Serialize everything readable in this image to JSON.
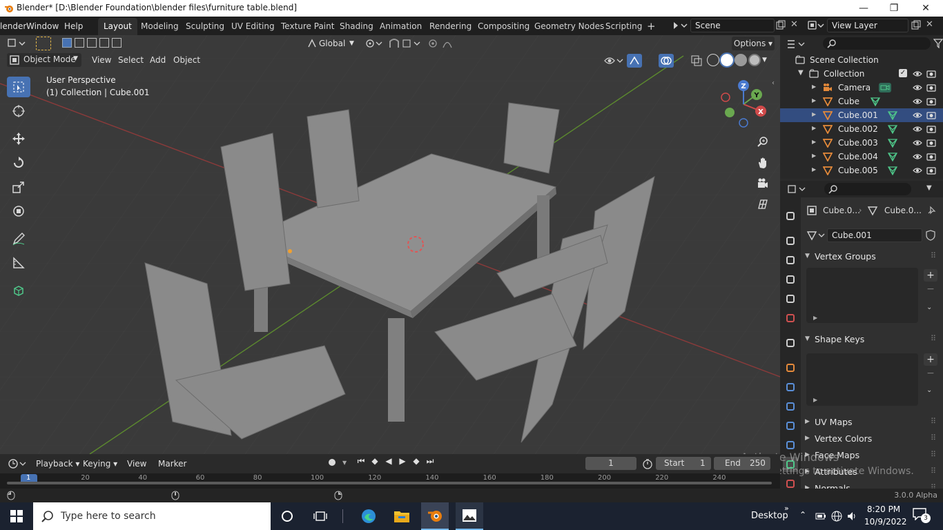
{
  "window": {
    "title": "Blender* [D:\\Blender Foundation\\blender files\\furniture table.blend]",
    "minimize_glyph": "—",
    "maximize_glyph": "❐",
    "close_glyph": "✕"
  },
  "menu": {
    "app": "lender",
    "window": "Window",
    "help": "Help"
  },
  "workspaces": [
    "Layout",
    "Modeling",
    "Sculpting",
    "UV Editing",
    "Texture Paint",
    "Shading",
    "Animation",
    "Rendering",
    "Compositing",
    "Geometry Nodes",
    "Scripting"
  ],
  "add_workspace": "+",
  "scene": {
    "name": "Scene"
  },
  "view_layer": {
    "name": "View Layer"
  },
  "viewport": {
    "transform_orientation": "Global",
    "options": "Options",
    "mode": "Object Mode",
    "menus": {
      "view": "View",
      "select": "Select",
      "add": "Add",
      "object": "Object"
    },
    "overlay_title": "User Perspective",
    "overlay_subtitle": "(1) Collection | Cube.001",
    "axes": {
      "x": "X",
      "y": "Y",
      "z": "Z"
    }
  },
  "outliner": {
    "scene_collection": "Scene Collection",
    "collection": "Collection",
    "items": [
      {
        "name": "Camera",
        "type": "camera"
      },
      {
        "name": "Cube",
        "type": "mesh"
      },
      {
        "name": "Cube.001",
        "type": "mesh",
        "selected": true
      },
      {
        "name": "Cube.002",
        "type": "mesh"
      },
      {
        "name": "Cube.003",
        "type": "mesh"
      },
      {
        "name": "Cube.004",
        "type": "mesh"
      },
      {
        "name": "Cube.005",
        "type": "mesh"
      }
    ]
  },
  "properties": {
    "breadcrumb_object": "Cube.0...",
    "breadcrumb_data": "Cube.0...",
    "data_name": "Cube.001",
    "panels": {
      "vertex_groups": "Vertex Groups",
      "shape_keys": "Shape Keys",
      "uv_maps": "UV Maps",
      "vertex_colors": "Vertex Colors",
      "face_maps": "Face Maps",
      "attributes": "Attributes",
      "normals": "Normals"
    }
  },
  "timeline": {
    "menus": {
      "playback": "Playback",
      "keying": "Keying",
      "view": "View",
      "marker": "Marker"
    },
    "current_frame": "1",
    "start_label": "Start",
    "start": "1",
    "end_label": "End",
    "end": "250",
    "ticks": [
      "1",
      "20",
      "40",
      "60",
      "80",
      "100",
      "120",
      "140",
      "160",
      "180",
      "200",
      "220",
      "240"
    ]
  },
  "statusbar": {
    "version": "3.0.0 Alpha"
  },
  "watermark": {
    "line1": "Activate Windows",
    "line2": "Go to Settings to activate Windows."
  },
  "taskbar": {
    "search_placeholder": "Type here to search",
    "desktop": "Desktop",
    "time": "8:20 PM",
    "date": "10/9/2022",
    "notifications": "3"
  },
  "colors": {
    "accent": "#4772b3",
    "selected_row": "#334d80",
    "mesh_icon": "#e58a3a",
    "data_icon": "#4fc88a"
  }
}
